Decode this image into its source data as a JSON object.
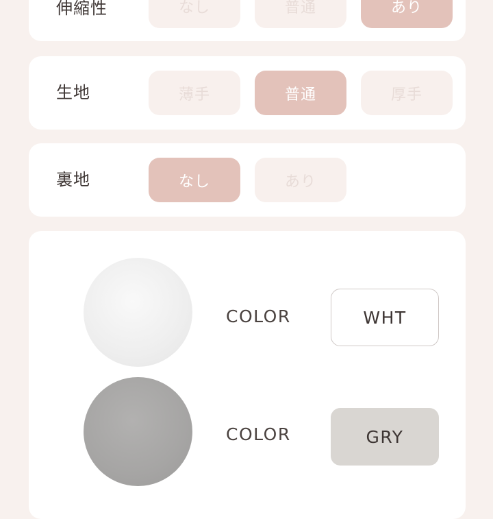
{
  "attributes": [
    {
      "label": "伸縮性",
      "options": [
        {
          "label": "なし",
          "selected": false
        },
        {
          "label": "普通",
          "selected": false
        },
        {
          "label": "あり",
          "selected": true
        }
      ]
    },
    {
      "label": "生地",
      "options": [
        {
          "label": "薄手",
          "selected": false
        },
        {
          "label": "普通",
          "selected": true
        },
        {
          "label": "厚手",
          "selected": false
        }
      ]
    },
    {
      "label": "裏地",
      "options": [
        {
          "label": "なし",
          "selected": true
        },
        {
          "label": "あり",
          "selected": false
        }
      ]
    }
  ],
  "colors": [
    {
      "label": "COLOR",
      "code": "WHT",
      "swatch": "#eeeeee"
    },
    {
      "label": "COLOR",
      "code": "GRY",
      "swatch": "#a8a7a6"
    }
  ],
  "theme": {
    "background": "#f8f1ee",
    "selected": "#e3c2ba",
    "unselected": "#f8f0ed",
    "unselected_text": "#e8dcd8"
  }
}
